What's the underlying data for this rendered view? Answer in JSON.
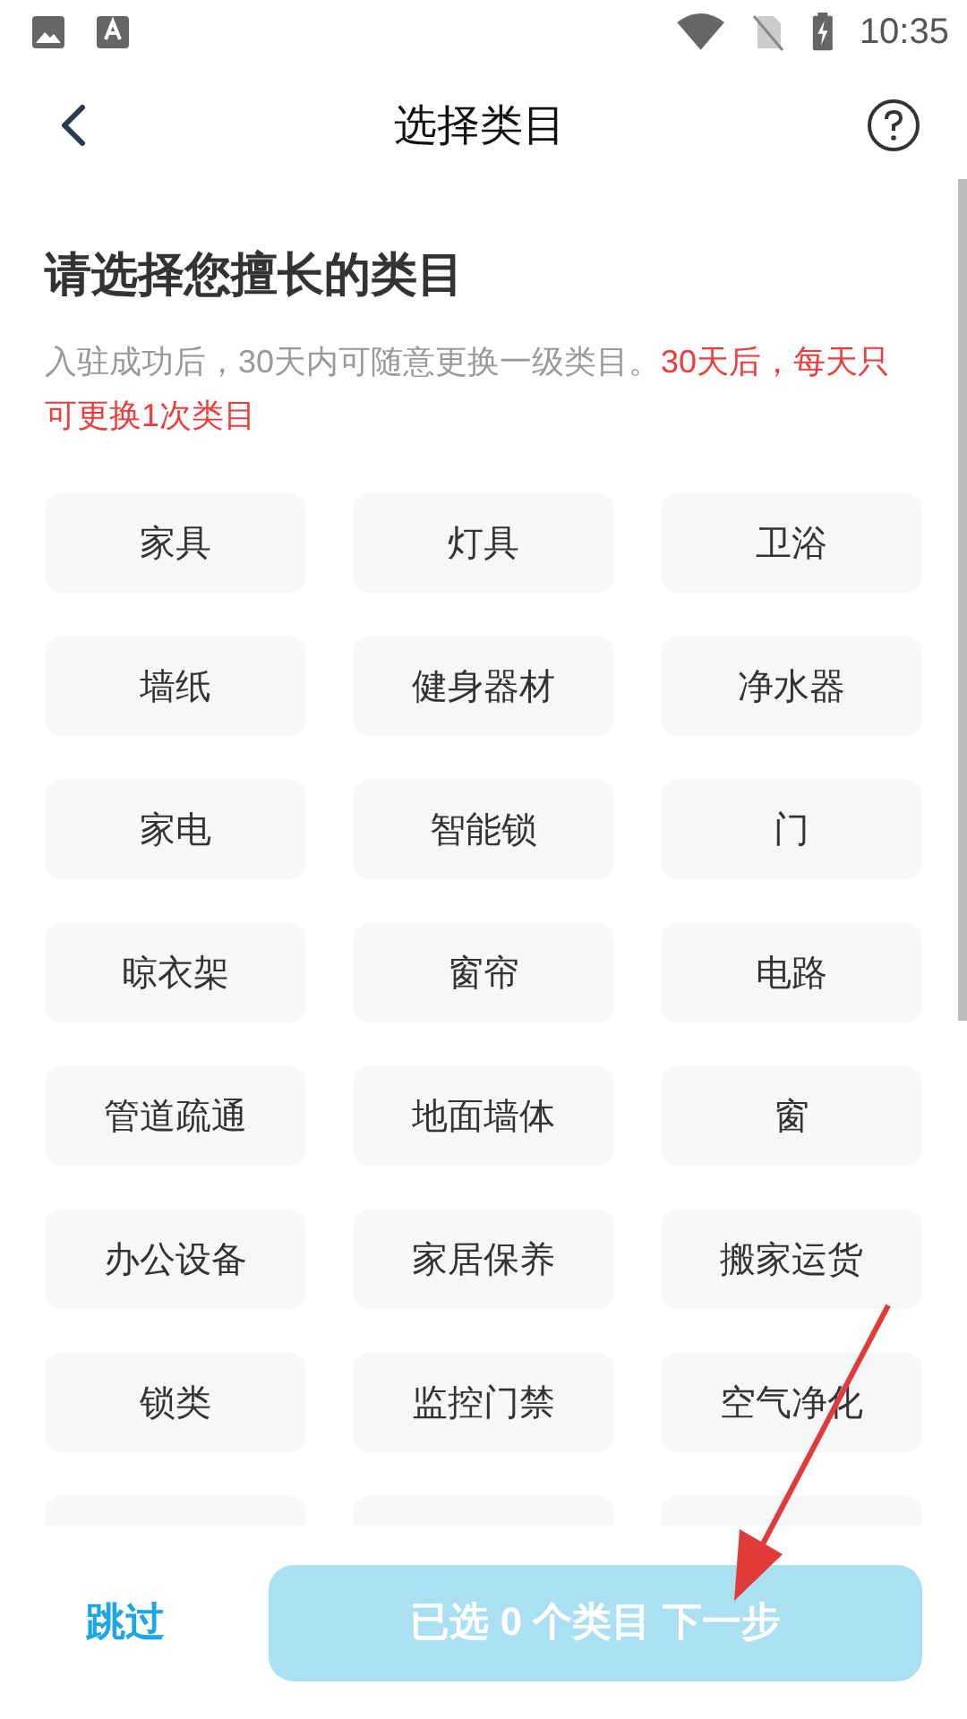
{
  "status_bar": {
    "time": "10:35"
  },
  "header": {
    "title": "选择类目"
  },
  "heading": "请选择您擅长的类目",
  "notice": {
    "text": "入驻成功后，30天内可随意更换一级类目。",
    "warning": "30天后，每天只可更换1次类目"
  },
  "categories": [
    {
      "label": "家具",
      "selected": false
    },
    {
      "label": "灯具",
      "selected": false
    },
    {
      "label": "卫浴",
      "selected": false
    },
    {
      "label": "墙纸",
      "selected": false
    },
    {
      "label": "健身器材",
      "selected": false
    },
    {
      "label": "净水器",
      "selected": false
    },
    {
      "label": "家电",
      "selected": false
    },
    {
      "label": "智能锁",
      "selected": false
    },
    {
      "label": "门",
      "selected": false
    },
    {
      "label": "晾衣架",
      "selected": false
    },
    {
      "label": "窗帘",
      "selected": false
    },
    {
      "label": "电路",
      "selected": false
    },
    {
      "label": "管道疏通",
      "selected": false
    },
    {
      "label": "地面墙体",
      "selected": false
    },
    {
      "label": "窗",
      "selected": false
    },
    {
      "label": "办公设备",
      "selected": false
    },
    {
      "label": "家居保养",
      "selected": false
    },
    {
      "label": "搬家运货",
      "selected": false
    },
    {
      "label": "锁类",
      "selected": false
    },
    {
      "label": "监控门禁",
      "selected": false
    },
    {
      "label": "空气净化",
      "selected": false
    }
  ],
  "footer": {
    "skip": "跳过",
    "next": {
      "label": "已选 0 个类目 下一步",
      "disabled": true
    }
  }
}
